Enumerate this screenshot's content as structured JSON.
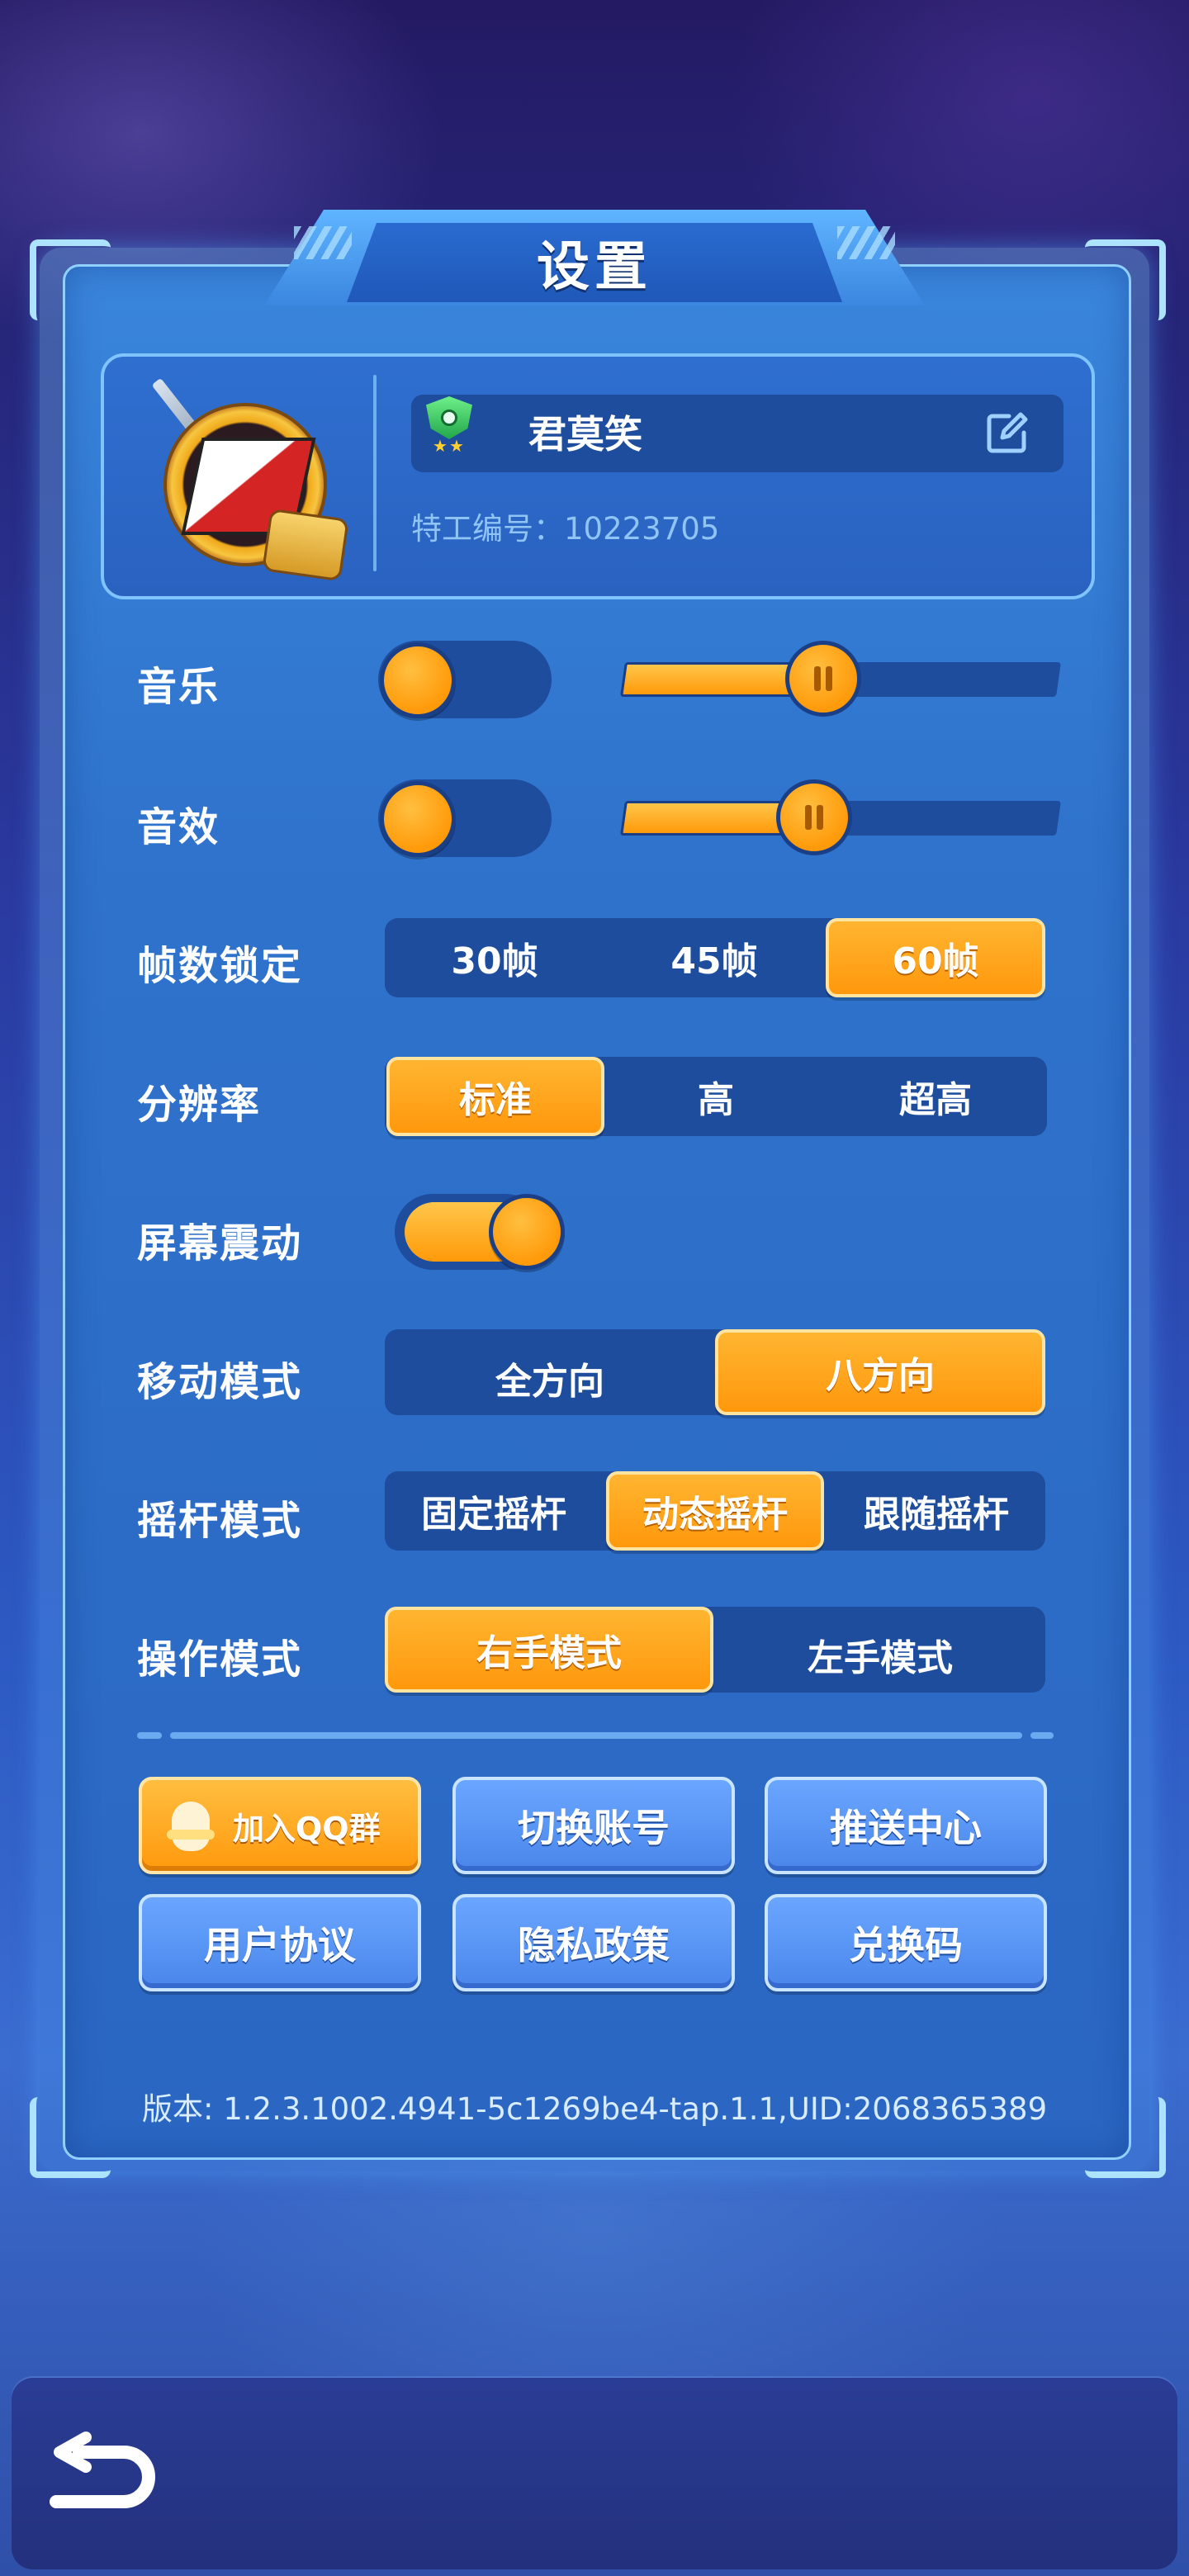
{
  "window": {
    "title": "设置"
  },
  "profile": {
    "name": "君莫笑",
    "agent_id": "特工编号：10223705"
  },
  "settings": {
    "music": {
      "label": "音乐",
      "toggle_on": false,
      "volume_fraction": 0.46
    },
    "sfx": {
      "label": "音效",
      "toggle_on": false,
      "volume_fraction": 0.44
    },
    "framerate": {
      "label": "帧数锁定",
      "options": [
        "30帧",
        "45帧",
        "60帧"
      ],
      "selected": "60帧"
    },
    "resolution": {
      "label": "分辨率",
      "options": [
        "标准",
        "高",
        "超高"
      ],
      "selected": "标准"
    },
    "shake": {
      "label": "屏幕震动",
      "on": true
    },
    "move_mode": {
      "label": "移动模式",
      "options": [
        "全方向",
        "八方向"
      ],
      "selected": "八方向"
    },
    "joystick_mode": {
      "label": "摇杆模式",
      "options": [
        "固定摇杆",
        "动态摇杆",
        "跟随摇杆"
      ],
      "selected": "动态摇杆"
    },
    "control_mode": {
      "label": "操作模式",
      "options": [
        "右手模式",
        "左手模式"
      ],
      "selected": "右手模式"
    }
  },
  "buttons": {
    "join_qq": "加入QQ群",
    "switch_account": "切换账号",
    "push_center": "推送中心",
    "user_agreement": "用户协议",
    "privacy_policy": "隐私政策",
    "redeem_code": "兑换码"
  },
  "version": "版本: 1.2.3.1002.4941-5c1269be4-tap.1.1,UID:2068365389",
  "icons": [
    "rank-badge-icon",
    "edit-icon",
    "qq-penguin-icon",
    "back-arrow-icon"
  ],
  "colors": {
    "accent": "#ff9a0a",
    "panel": "#2f73cc",
    "track": "#1d4d9c"
  }
}
